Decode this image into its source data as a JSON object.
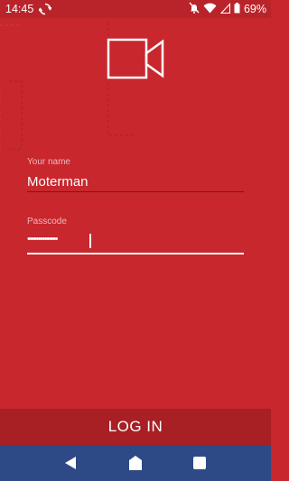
{
  "status_bar": {
    "time": "14:45",
    "battery": "69%",
    "icons": [
      "sync-icon",
      "mute-icon",
      "wifi-icon",
      "signal-icon",
      "battery-icon"
    ]
  },
  "app": {
    "logo_icon": "video-camera-icon"
  },
  "form": {
    "name_label": "Your name",
    "name_value": "Moterman",
    "passcode_label": "Passcode",
    "passcode_value": "••••••••••••••"
  },
  "login_button": {
    "label": "LOG IN"
  },
  "nav_bar": {
    "items": [
      "back",
      "home",
      "recents"
    ]
  },
  "colors": {
    "background": "#c7272d",
    "button": "#a81f24",
    "nav_bar": "#2e4a86",
    "label": "#f2b8ba"
  }
}
